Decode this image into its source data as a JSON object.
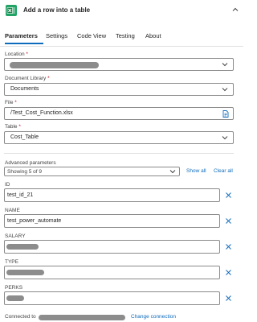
{
  "header": {
    "title": "Add a row into a table",
    "app_icon": "excel-icon",
    "brand_color": "#21a366"
  },
  "tabs": [
    {
      "label": "Parameters",
      "active": true
    },
    {
      "label": "Settings",
      "active": false
    },
    {
      "label": "Code View",
      "active": false
    },
    {
      "label": "Testing",
      "active": false
    },
    {
      "label": "About",
      "active": false
    }
  ],
  "fields": {
    "location": {
      "label": "Location",
      "required_mark": "*",
      "value": ""
    },
    "document_library": {
      "label": "Document Library",
      "required_mark": "*",
      "value": "Documents"
    },
    "file": {
      "label": "File",
      "required_mark": "*",
      "value": "/Test_Cost_Function.xlsx"
    },
    "table": {
      "label": "Table",
      "required_mark": "*",
      "value": "Cost_Table"
    }
  },
  "advanced": {
    "label": "Advanced parameters",
    "selected": "Showing 5 of 9",
    "show_all": "Show all",
    "clear_all": "Clear all"
  },
  "params": [
    {
      "label": "ID",
      "value": "test_id_21"
    },
    {
      "label": "NAME",
      "value": "test_power_automate"
    },
    {
      "label": "SALARY",
      "value": ""
    },
    {
      "label": "TYPE",
      "value": ""
    },
    {
      "label": "PERKS",
      "value": ""
    }
  ],
  "footer": {
    "connected_to": "Connected to",
    "change_connection": "Change connection"
  },
  "colors": {
    "accent": "#0f6cbd",
    "required": "#c50f1f",
    "redaction": "#8c8c8c"
  }
}
